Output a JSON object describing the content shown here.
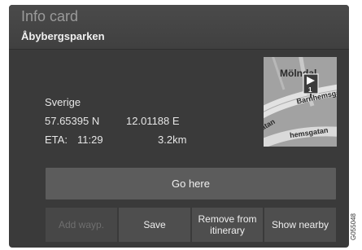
{
  "header": {
    "title": "Info card",
    "subtitle": "Åbybergsparken"
  },
  "location": {
    "country": "Sverige",
    "latitude": "57.65395 N",
    "longitude": "12.01188 E",
    "eta_label": "ETA:",
    "eta_time": "11:29",
    "distance": "3.2km"
  },
  "map": {
    "place_label": "Mölndal",
    "street_1": "Barnhemsga",
    "street_2": "atan",
    "street_3": "hemsgatan",
    "marker_number": "1"
  },
  "actions": {
    "go_here": "Go here",
    "add_waypoint": "Add wayp.",
    "save": "Save",
    "remove_from_itinerary": "Remove from itinerary",
    "show_nearby": "Show nearby"
  },
  "figure_code": "G055048"
}
